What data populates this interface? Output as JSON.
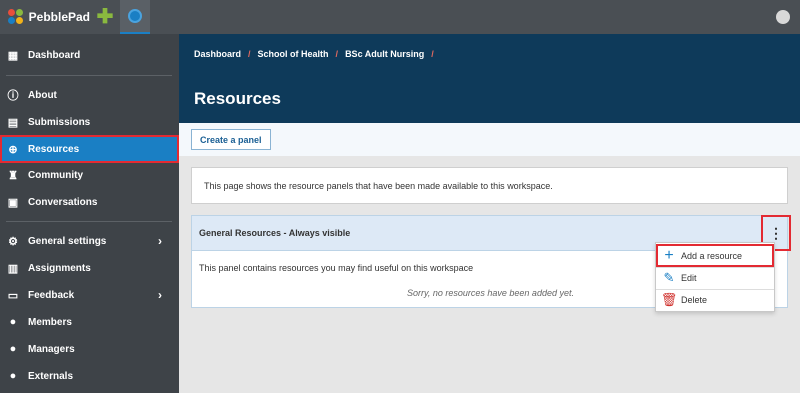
{
  "app": {
    "name": "PebblePad"
  },
  "sidebar": {
    "items": [
      {
        "label": "Dashboard",
        "icon": "dashboard-icon"
      },
      {
        "label": "About",
        "icon": "info-icon"
      },
      {
        "label": "Submissions",
        "icon": "file-icon"
      },
      {
        "label": "Resources",
        "icon": "globe-icon",
        "active": true
      },
      {
        "label": "Community",
        "icon": "community-icon"
      },
      {
        "label": "Conversations",
        "icon": "chat-icon"
      },
      {
        "label": "General settings",
        "icon": "gear-icon",
        "expandable": true
      },
      {
        "label": "Assignments",
        "icon": "document-icon"
      },
      {
        "label": "Feedback",
        "icon": "feedback-icon",
        "expandable": true
      },
      {
        "label": "Members",
        "icon": "person-icon"
      },
      {
        "label": "Managers",
        "icon": "person-icon"
      },
      {
        "label": "Externals",
        "icon": "person-icon"
      }
    ]
  },
  "breadcrumb": [
    "Dashboard",
    "School of Health",
    "BSc Adult Nursing"
  ],
  "breadcrumb_sep": "/",
  "page": {
    "title": "Resources"
  },
  "toolbar": {
    "create_panel_label": "Create a panel"
  },
  "info": {
    "text": "This page shows the resource panels that have been made available to this workspace."
  },
  "panel": {
    "title": "General Resources - Always visible",
    "description": "This panel contains resources you may find useful on this workspace",
    "empty_text": "Sorry, no resources have been added yet."
  },
  "menu": {
    "items": [
      {
        "label": "Add a resource",
        "icon": "plus-icon"
      },
      {
        "label": "Edit",
        "icon": "pencil-icon"
      },
      {
        "label": "Delete",
        "icon": "trash-icon"
      }
    ]
  },
  "colors": {
    "header": "#0e3a5a",
    "sidebar": "#3e4348",
    "accent": "#1a7fc4",
    "highlight": "#e32a32"
  }
}
